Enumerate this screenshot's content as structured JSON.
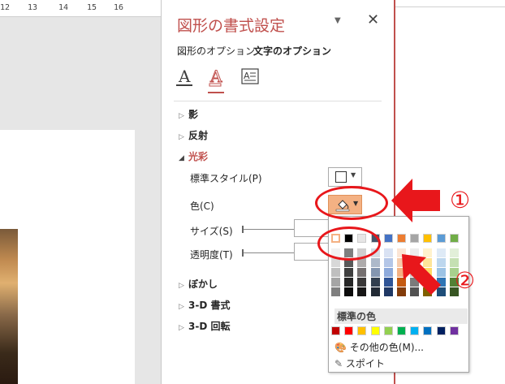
{
  "ruler": {
    "marks": [
      "12",
      "13",
      "14",
      "15",
      "16"
    ]
  },
  "pane": {
    "title": "図形の書式設定",
    "options_glyph": "▼",
    "close_glyph": "✕",
    "tabs": [
      "図形のオプション",
      "文字のオプション"
    ],
    "icon_tabs": [
      "text-fill-outline-icon",
      "text-effects-icon",
      "textbox-layout-icon"
    ]
  },
  "sections": {
    "shadow": "影",
    "reflection": "反射",
    "glow": "光彩",
    "soft_edges": "ぼかし",
    "bevel": "3-D 書式",
    "rotation": "3-D 回転"
  },
  "glow": {
    "preset_label": "標準スタイル(P)",
    "color_label": "色(C)",
    "size_label": "サイズ(S)",
    "transparency_label": "透明度(T)"
  },
  "picker": {
    "theme_row1": [
      "#ffffff",
      "#000000",
      "#e7e6e6",
      "#44546a",
      "#4472c4",
      "#ed7d31",
      "#a5a5a5",
      "#ffc000",
      "#5b9bd5",
      "#70ad47"
    ],
    "theme_shades": [
      [
        "#f2f2f2",
        "#7f7f7f",
        "#d0cece",
        "#d6dce4",
        "#d9e2f3",
        "#fbe5d5",
        "#ededed",
        "#fff2cc",
        "#deeaf6",
        "#e2efd9"
      ],
      [
        "#d8d8d8",
        "#595959",
        "#aeabab",
        "#adb9ca",
        "#b4c6e7",
        "#f7cbac",
        "#dbdbdb",
        "#fee599",
        "#bdd7ee",
        "#c5e0b3"
      ],
      [
        "#bfbfbf",
        "#3f3f3f",
        "#757070",
        "#8496b0",
        "#8eaadb",
        "#f4b183",
        "#c9c9c9",
        "#ffd965",
        "#9cc3e5",
        "#a8d08d"
      ],
      [
        "#a5a5a5",
        "#262626",
        "#3a3838",
        "#323f4f",
        "#2f5496",
        "#c55a11",
        "#7b7b7b",
        "#bf8f00",
        "#2e75b5",
        "#538135"
      ],
      [
        "#7f7f7f",
        "#0c0c0c",
        "#171616",
        "#222a35",
        "#1f3864",
        "#833c0b",
        "#525252",
        "#7f6000",
        "#1e4e79",
        "#375623"
      ]
    ],
    "standard_label": "標準の色",
    "standard_colors": [
      "#c00000",
      "#ff0000",
      "#ffc000",
      "#ffff00",
      "#92d050",
      "#00b050",
      "#00b0f0",
      "#0070c0",
      "#002060",
      "#7030a0"
    ],
    "more_colors": "その他の色(M)...",
    "eyedropper": "スポイト"
  },
  "annotations": [
    "①",
    "②"
  ],
  "colors": {
    "accent": "#c0504d",
    "annotation": "#e8171b",
    "selected_button": "#f4b183"
  }
}
